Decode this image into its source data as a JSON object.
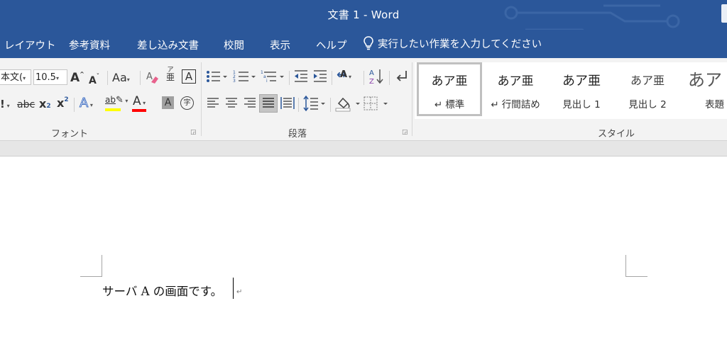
{
  "window": {
    "title": "文書 1  -  Word"
  },
  "tabs": [
    "レイアウト",
    "参考資料",
    "差し込み文書",
    "校閲",
    "表示",
    "ヘルプ"
  ],
  "tell_me": "実行したい作業を入力してください",
  "font_group": {
    "font_name": "本文(",
    "font_size": "10.5",
    "grow_glyph": "A",
    "shrink_glyph": "A",
    "change_case": "Aa",
    "phonetic_top": "ア",
    "phonetic_bottom": "亜",
    "char_border": "A",
    "strike": "abc",
    "subscript": "x",
    "subscript_mark": "2",
    "superscript": "x",
    "superscript_mark": "2",
    "text_effects": "A",
    "highlight": "ab",
    "font_color": "A",
    "shading": "A",
    "enclose": "字",
    "label": "フォント",
    "highlight_color": "#ffff00",
    "font_color_bar": "#ff0000"
  },
  "paragraph_group": {
    "label": "段落",
    "sort_glyph": "A"
  },
  "styles_group": {
    "label": "スタイル",
    "items": [
      {
        "sample": "あア亜",
        "name": "↵ 標準",
        "selected": true
      },
      {
        "sample": "あア亜",
        "name": "↵ 行間詰め",
        "selected": false
      },
      {
        "sample": "あア亜",
        "name": "見出し 1",
        "selected": false
      },
      {
        "sample": "あア亜",
        "name": "見出し 2",
        "selected": false
      },
      {
        "sample": "あア",
        "name": "表題",
        "selected": false
      }
    ]
  },
  "document": {
    "text": "サーバ A の画面です。",
    "paragraph_mark": "↵"
  },
  "colors": {
    "title_bar": "#2b579a",
    "ribbon": "#f3f3f3",
    "page": "#ffffff"
  }
}
